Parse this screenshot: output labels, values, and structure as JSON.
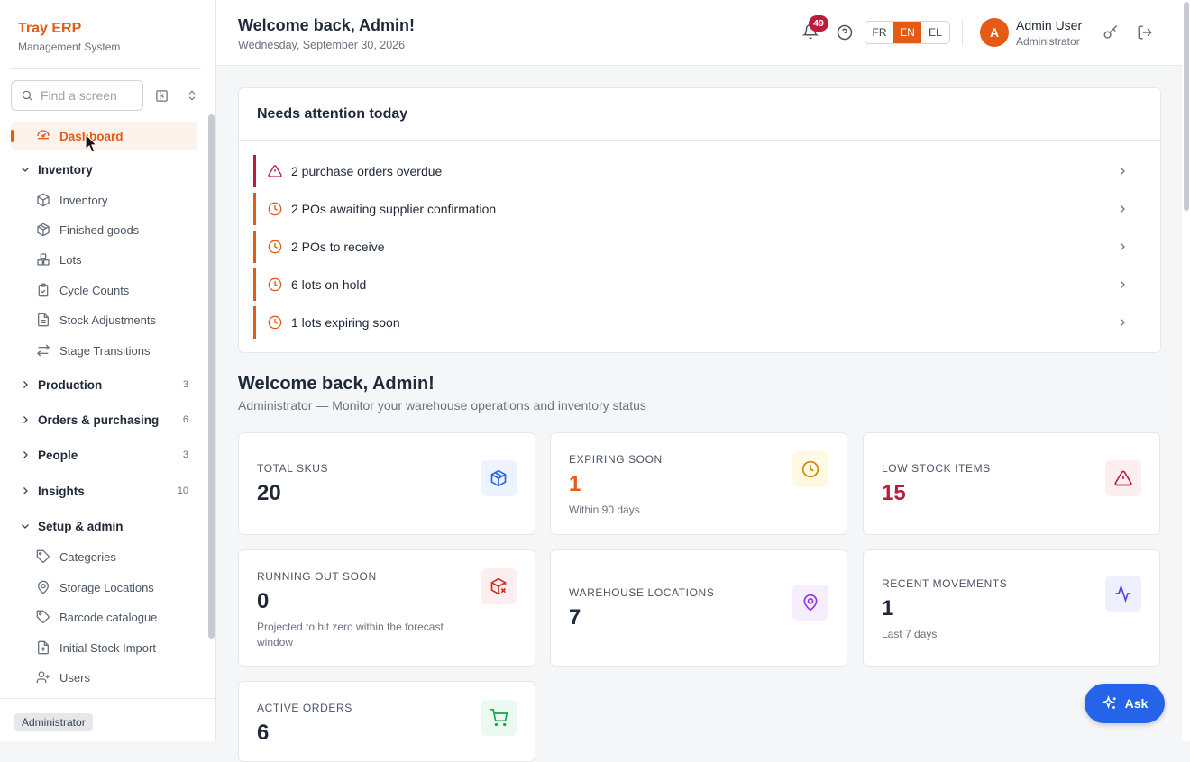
{
  "brand": {
    "title": "Tray ERP",
    "subtitle": "Management System"
  },
  "search": {
    "placeholder": "Find a screen"
  },
  "sidebar": {
    "active": "Dashboard",
    "inventory_group": {
      "label": "Inventory",
      "items": [
        "Inventory",
        "Finished goods",
        "Lots",
        "Cycle Counts",
        "Stock Adjustments",
        "Stage Transitions"
      ]
    },
    "groups": [
      {
        "label": "Production",
        "count": "3"
      },
      {
        "label": "Orders & purchasing",
        "count": "6"
      },
      {
        "label": "People",
        "count": "3"
      },
      {
        "label": "Insights",
        "count": "10"
      }
    ],
    "setup_group": {
      "label": "Setup & admin",
      "items": [
        "Categories",
        "Storage Locations",
        "Barcode catalogue",
        "Initial Stock Import",
        "Users"
      ]
    },
    "footer_role": "Administrator"
  },
  "header": {
    "title": "Welcome back, Admin!",
    "date": "Wednesday, September 30, 2026",
    "notifications": "49",
    "languages": [
      "FR",
      "EN",
      "EL"
    ],
    "active_language": "EN",
    "avatar_initial": "A",
    "user_name": "Admin User",
    "user_role": "Administrator"
  },
  "attention": {
    "title": "Needs attention today",
    "items": [
      {
        "text": "2 purchase orders overdue",
        "level": "danger"
      },
      {
        "text": "2 POs awaiting supplier confirmation",
        "level": "warning"
      },
      {
        "text": "2 POs to receive",
        "level": "warning"
      },
      {
        "text": "6 lots on hold",
        "level": "warning"
      },
      {
        "text": "1 lots expiring soon",
        "level": "warning"
      }
    ]
  },
  "welcome": {
    "title": "Welcome back, Admin!",
    "subtitle": "Administrator — Monitor your warehouse operations and inventory status"
  },
  "stats": [
    {
      "label": "TOTAL SKUS",
      "value": "20",
      "note": "",
      "icon": "box-icon",
      "accent": "#2563eb"
    },
    {
      "label": "EXPIRING SOON",
      "value": "1",
      "note": "Within 90 days",
      "icon": "clock-icon",
      "accent": "#ca8a04"
    },
    {
      "label": "LOW STOCK ITEMS",
      "value": "15",
      "note": "",
      "icon": "warning-icon",
      "accent": "#b91c3c"
    },
    {
      "label": "RUNNING OUT SOON",
      "value": "0",
      "note": "Projected to hit zero within the forecast window",
      "icon": "package-x-icon",
      "accent": "#dc2626"
    },
    {
      "label": "WAREHOUSE LOCATIONS",
      "value": "7",
      "note": "",
      "icon": "map-pin-icon",
      "accent": "#9333ea"
    },
    {
      "label": "RECENT MOVEMENTS",
      "value": "1",
      "note": "Last 7 days",
      "icon": "activity-icon",
      "accent": "#4f46e5"
    },
    {
      "label": "ACTIVE ORDERS",
      "value": "6",
      "note": "",
      "icon": "cart-icon",
      "accent": "#16a34a"
    }
  ],
  "ask_button": "Ask"
}
